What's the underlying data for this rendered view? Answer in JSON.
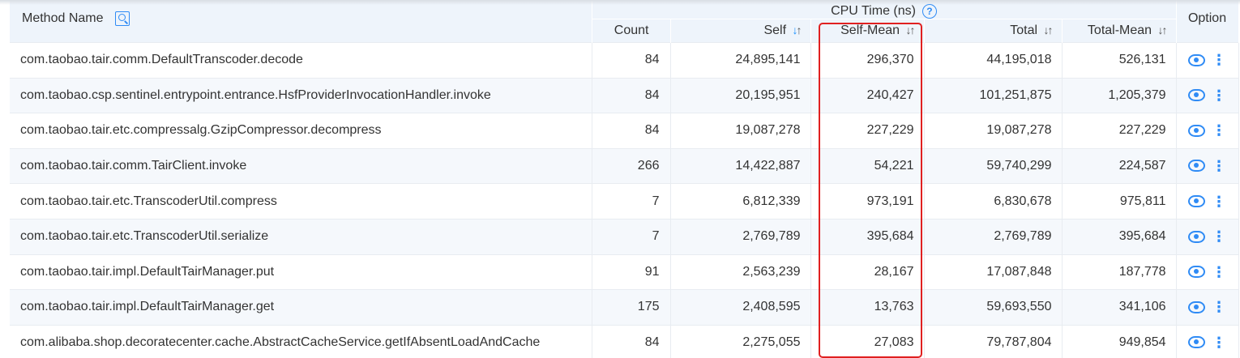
{
  "header": {
    "method_name": "Method Name",
    "method_search_icon": "search-icon",
    "cpu_group": "CPU Time (ns)",
    "cpu_help_icon": "help-icon",
    "count": "Count",
    "self": "Self",
    "self_mean": "Self-Mean",
    "total": "Total",
    "total_mean": "Total-Mean",
    "option": "Option",
    "sort_glyph": "↓↑",
    "sort_active_color": "#1890ff"
  },
  "highlight_color": "#e02020",
  "accent_color": "#2f8bf5",
  "rows": [
    {
      "method": "com.taobao.tair.comm.DefaultTranscoder.decode",
      "count": "84",
      "self": "24,895,141",
      "self_mean": "296,370",
      "total": "44,195,018",
      "total_mean": "526,131"
    },
    {
      "method": "com.taobao.csp.sentinel.entrypoint.entrance.HsfProviderInvocationHandler.invoke",
      "count": "84",
      "self": "20,195,951",
      "self_mean": "240,427",
      "total": "101,251,875",
      "total_mean": "1,205,379"
    },
    {
      "method": "com.taobao.tair.etc.compressalg.GzipCompressor.decompress",
      "count": "84",
      "self": "19,087,278",
      "self_mean": "227,229",
      "total": "19,087,278",
      "total_mean": "227,229"
    },
    {
      "method": "com.taobao.tair.comm.TairClient.invoke",
      "count": "266",
      "self": "14,422,887",
      "self_mean": "54,221",
      "total": "59,740,299",
      "total_mean": "224,587"
    },
    {
      "method": "com.taobao.tair.etc.TranscoderUtil.compress",
      "count": "7",
      "self": "6,812,339",
      "self_mean": "973,191",
      "total": "6,830,678",
      "total_mean": "975,811"
    },
    {
      "method": "com.taobao.tair.etc.TranscoderUtil.serialize",
      "count": "7",
      "self": "2,769,789",
      "self_mean": "395,684",
      "total": "2,769,789",
      "total_mean": "395,684"
    },
    {
      "method": "com.taobao.tair.impl.DefaultTairManager.put",
      "count": "91",
      "self": "2,563,239",
      "self_mean": "28,167",
      "total": "17,087,848",
      "total_mean": "187,778"
    },
    {
      "method": "com.taobao.tair.impl.DefaultTairManager.get",
      "count": "175",
      "self": "2,408,595",
      "self_mean": "13,763",
      "total": "59,693,550",
      "total_mean": "341,106"
    },
    {
      "method": "com.alibaba.shop.decoratecenter.cache.AbstractCacheService.getIfAbsentLoadAndCache",
      "count": "84",
      "self": "2,275,055",
      "self_mean": "27,083",
      "total": "79,787,804",
      "total_mean": "949,854"
    }
  ],
  "row_icons": {
    "view": "eye-icon",
    "more": "more-icon",
    "more_glyph": "⋮"
  }
}
